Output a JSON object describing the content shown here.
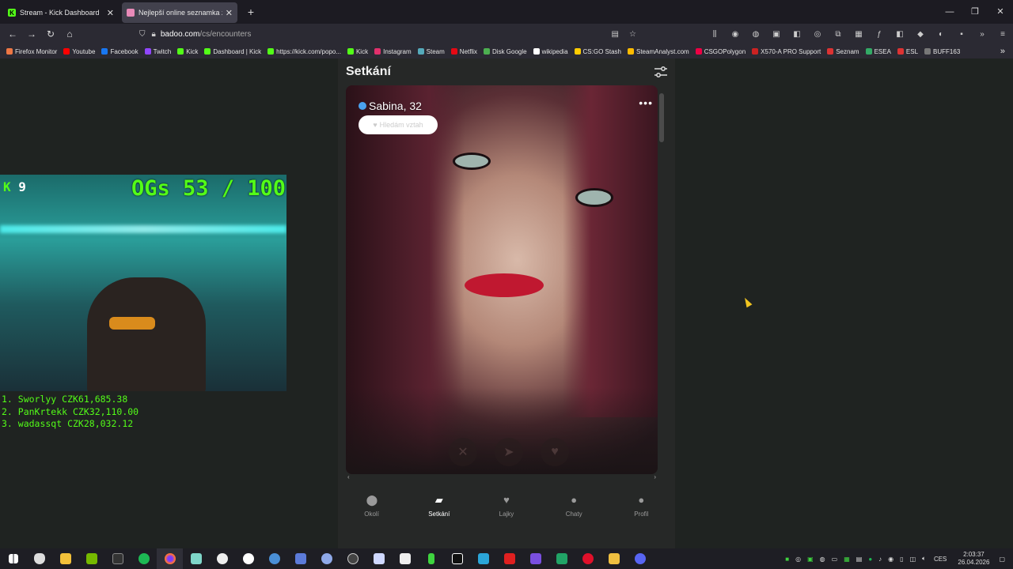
{
  "browser": {
    "tabs": [
      {
        "title": "Stream - Kick Dashboard",
        "active": false,
        "favicon": "kick-icon",
        "color": "#53fc18"
      },
      {
        "title": "Nejlepší online seznamka zdarm",
        "active": true,
        "favicon": "badoo-icon",
        "color": "#e88ab8"
      }
    ],
    "url_domain": "badoo.com",
    "url_path": "/cs/encounters",
    "bookmarks": [
      "Firefox Monitor",
      "Youtube",
      "Facebook",
      "Twitch",
      "Kick",
      "Dashboard | Kick",
      "https://kick.com/popo...",
      "Kick",
      "Instagram",
      "Steam",
      "Netflix",
      "Disk Google",
      "wikipedia",
      "CS:GO Stash",
      "SteamAnalyst.com",
      "CSGOPolygon",
      "X570-A PRO Support",
      "Seznam",
      "ESEA",
      "ESL",
      "BUFF163"
    ]
  },
  "stream_overlay": {
    "kick_count": "9",
    "ogs": "OGs 53 / 100",
    "leaderboard": [
      "1. Sworlyy CZK61,685.38",
      "2. PanKrtekk CZK32,110.00",
      "3. wadassqt CZK28,032.12"
    ]
  },
  "badoo": {
    "header": "Setkání",
    "profile": {
      "name_age": "Sabina, 32",
      "badge": "Hledám vztah"
    },
    "nav": [
      {
        "label": "Okolí",
        "icon": "location-pin-icon",
        "active": false
      },
      {
        "label": "Setkání",
        "icon": "cards-icon",
        "active": true
      },
      {
        "label": "Lajky",
        "icon": "heart-icon",
        "active": false
      },
      {
        "label": "Chaty",
        "icon": "chat-icon",
        "active": false
      },
      {
        "label": "Profil",
        "icon": "person-icon",
        "active": false
      }
    ]
  },
  "taskbar": {
    "lang": "CES",
    "time": "2:03:37",
    "date": "26.04.2026"
  }
}
